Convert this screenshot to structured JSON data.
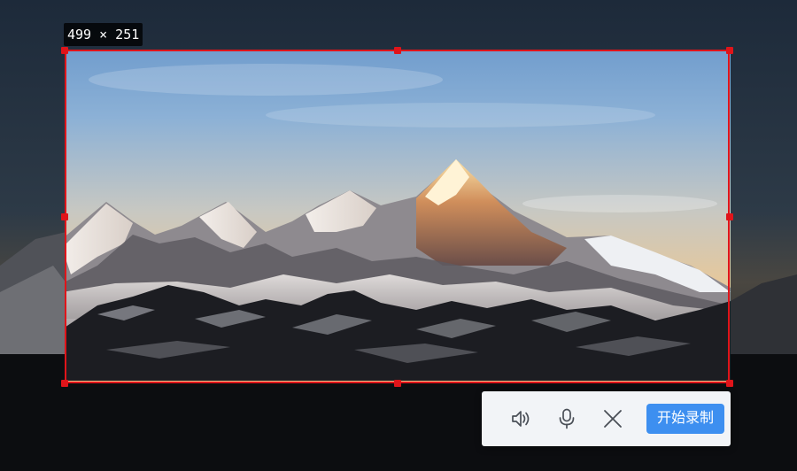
{
  "capture": {
    "size_label": "499 × 251"
  },
  "toolbar": {
    "speaker_icon": "speaker-icon",
    "microphone_icon": "microphone-icon",
    "close_icon": "close-icon",
    "start_recording_label": "开始录制"
  },
  "colors": {
    "selection_border": "#e0141a",
    "toolbar_bg": "#f2f4f7",
    "start_button": "#3d8ff0",
    "icon": "#4a4f57"
  }
}
